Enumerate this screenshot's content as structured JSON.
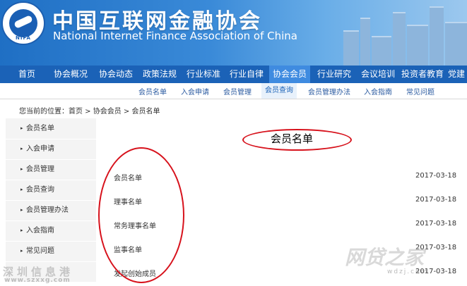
{
  "header": {
    "logo_text": "NIFA",
    "title_cn": "中国互联网金融协会",
    "title_en": "National Internet Finance Association of China"
  },
  "nav": {
    "items": [
      "首页",
      "协会概况",
      "协会动态",
      "政策法规",
      "行业标准",
      "行业自律",
      "协会会员",
      "行业研究",
      "会议培训",
      "投资者教育",
      "党建"
    ],
    "active": "协会会员"
  },
  "subnav": {
    "items": [
      "会员名单",
      "入会申请",
      "会员管理",
      "会员查询",
      "会员管理办法",
      "入会指南",
      "常见问题"
    ],
    "active": "会员查询"
  },
  "breadcrumb": "您当前的位置：首页 > 协会会员 > 会员名单",
  "sidebar": {
    "items": [
      "会员名单",
      "入会申请",
      "会员管理",
      "会员查询",
      "会员管理办法",
      "入会指南",
      "常见问题"
    ]
  },
  "content": {
    "title": "会员名单",
    "list": [
      {
        "name": "会员名单",
        "date": "2017-03-18"
      },
      {
        "name": "理事名单",
        "date": "2017-03-18"
      },
      {
        "name": "常务理事名单",
        "date": "2017-03-18"
      },
      {
        "name": "监事名单",
        "date": "2017-03-18"
      },
      {
        "name": "发起创始成员",
        "date": "2017-03-18"
      }
    ]
  },
  "watermarks": {
    "left_text": "深圳信息港",
    "left_url": "www.szxxg.com",
    "right_text": "网贷之家",
    "right_url": "wdzj.com"
  },
  "colors": {
    "nav_bg": "#1b62b7",
    "nav_active": "#3f8be0",
    "annotation_red": "#d7121c"
  }
}
